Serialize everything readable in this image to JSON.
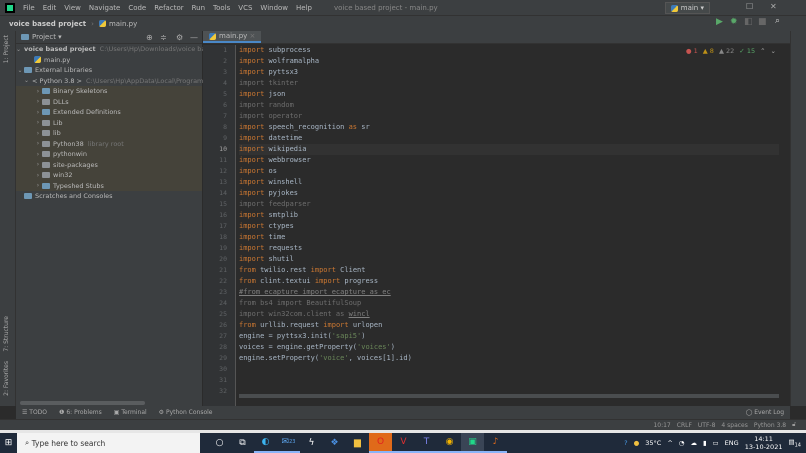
{
  "menu": [
    "File",
    "Edit",
    "View",
    "Navigate",
    "Code",
    "Refactor",
    "Run",
    "Tools",
    "VCS",
    "Window",
    "Help"
  ],
  "window_title": "voice based project - main.py",
  "breadcrumb": {
    "project": "voice based project",
    "file": "main.py"
  },
  "run_config": "main",
  "project_panel": {
    "title": "Project",
    "root": {
      "name": "voice based project",
      "path": "C:\\Users\\Hp\\Downloads\\voice based"
    },
    "root_file": "main.py",
    "ext_libs": "External Libraries",
    "python": {
      "name": "< Python 3.8 >",
      "path": "C:\\Users\\Hp\\AppData\\Local\\Programs\\"
    },
    "lib_items": [
      {
        "name": "Binary Skeletons",
        "blue": true,
        "hint": ""
      },
      {
        "name": "DLLs",
        "blue": false,
        "hint": ""
      },
      {
        "name": "Extended Definitions",
        "blue": true,
        "hint": ""
      },
      {
        "name": "Lib",
        "blue": false,
        "hint": ""
      },
      {
        "name": "lib",
        "blue": false,
        "hint": ""
      },
      {
        "name": "Python38",
        "blue": false,
        "hint": "library root"
      },
      {
        "name": "pythonwin",
        "blue": false,
        "hint": ""
      },
      {
        "name": "site-packages",
        "blue": false,
        "hint": ""
      },
      {
        "name": "win32",
        "blue": false,
        "hint": ""
      },
      {
        "name": "Typeshed Stubs",
        "blue": true,
        "hint": ""
      }
    ],
    "scratches": "Scratches and Consoles"
  },
  "side_labels": {
    "project": "1: Project",
    "structure": "7: Structure",
    "favorites": "2: Favorites"
  },
  "editor": {
    "tab": "main.py",
    "current_line": 10,
    "inspections": {
      "errors": "1",
      "warnings": "8",
      "weak": "22",
      "ok": "15"
    },
    "lines": [
      [
        [
          "kw",
          "import "
        ],
        [
          "",
          "subprocess"
        ]
      ],
      [
        [
          "kw",
          "import "
        ],
        [
          "",
          "wolframalpha"
        ]
      ],
      [
        [
          "kw",
          "import "
        ],
        [
          "",
          "pyttsx3"
        ]
      ],
      [
        [
          "dim",
          "import tkinter"
        ]
      ],
      [
        [
          "kw",
          "import "
        ],
        [
          "",
          "json"
        ]
      ],
      [
        [
          "dim",
          "import random"
        ]
      ],
      [
        [
          "dim",
          "import operator"
        ]
      ],
      [
        [
          "kw",
          "import "
        ],
        [
          "",
          "speech_recognition "
        ],
        [
          "kw",
          "as "
        ],
        [
          "",
          "sr"
        ]
      ],
      [
        [
          "kw",
          "import "
        ],
        [
          "",
          "datetime"
        ]
      ],
      [
        [
          "kw",
          "import "
        ],
        [
          "",
          "wikipedia"
        ]
      ],
      [
        [
          "kw",
          "import "
        ],
        [
          "",
          "webbrowser"
        ]
      ],
      [
        [
          "kw",
          "import "
        ],
        [
          "",
          "os"
        ]
      ],
      [
        [
          "kw",
          "import "
        ],
        [
          "",
          "winshell"
        ]
      ],
      [
        [
          "kw",
          "import "
        ],
        [
          "",
          "pyjokes"
        ]
      ],
      [
        [
          "dim",
          "import feedparser"
        ]
      ],
      [
        [
          "kw",
          "import "
        ],
        [
          "",
          "smtplib"
        ]
      ],
      [
        [
          "kw",
          "import "
        ],
        [
          "",
          "ctypes"
        ]
      ],
      [
        [
          "kw",
          "import "
        ],
        [
          "",
          "time"
        ]
      ],
      [
        [
          "kw",
          "import "
        ],
        [
          "",
          "requests"
        ]
      ],
      [
        [
          "kw",
          "import "
        ],
        [
          "",
          "shutil"
        ]
      ],
      [
        [
          "kw",
          "from "
        ],
        [
          "",
          "twilio.rest "
        ],
        [
          "kw",
          "import "
        ],
        [
          "",
          "Client"
        ]
      ],
      [
        [
          "kw",
          "from "
        ],
        [
          "",
          "clint.textui "
        ],
        [
          "kw",
          "import "
        ],
        [
          "",
          "progress"
        ]
      ],
      [
        [
          "cm",
          "#from ecapture import ecapture as ec"
        ]
      ],
      [
        [
          "dim",
          "from bs4 import BeautifulSoup"
        ]
      ],
      [
        [
          "dim",
          "import win32com.client as "
        ],
        [
          "cm",
          "wincl"
        ]
      ],
      [
        [
          "kw",
          "from "
        ],
        [
          "",
          "urllib.request "
        ],
        [
          "kw",
          "import "
        ],
        [
          "",
          "urlopen"
        ]
      ],
      [
        [
          "",
          "engine = pyttsx3.init("
        ],
        [
          "str",
          "'sapi5'"
        ],
        [
          "",
          ")"
        ]
      ],
      [
        [
          "",
          "voices = engine.getProperty("
        ],
        [
          "str",
          "'voices'"
        ],
        [
          "",
          ")"
        ]
      ],
      [
        [
          "",
          "engine.setProperty("
        ],
        [
          "str",
          "'voice'"
        ],
        [
          "",
          ", voices[1].id)"
        ]
      ],
      [],
      [],
      []
    ]
  },
  "tool_tabs": [
    "TODO",
    "6: Problems",
    "Terminal",
    "Python Console"
  ],
  "event_log": "Event Log",
  "status": [
    "10:17",
    "CRLF",
    "UTF-8",
    "4 spaces",
    "Python 3.8"
  ],
  "taskbar": {
    "search": "Type here to search",
    "temp": "35°C",
    "lang": "ENG",
    "time": "14:11",
    "date": "13-10-2021",
    "mail_badge": "23",
    "notif": "14"
  }
}
